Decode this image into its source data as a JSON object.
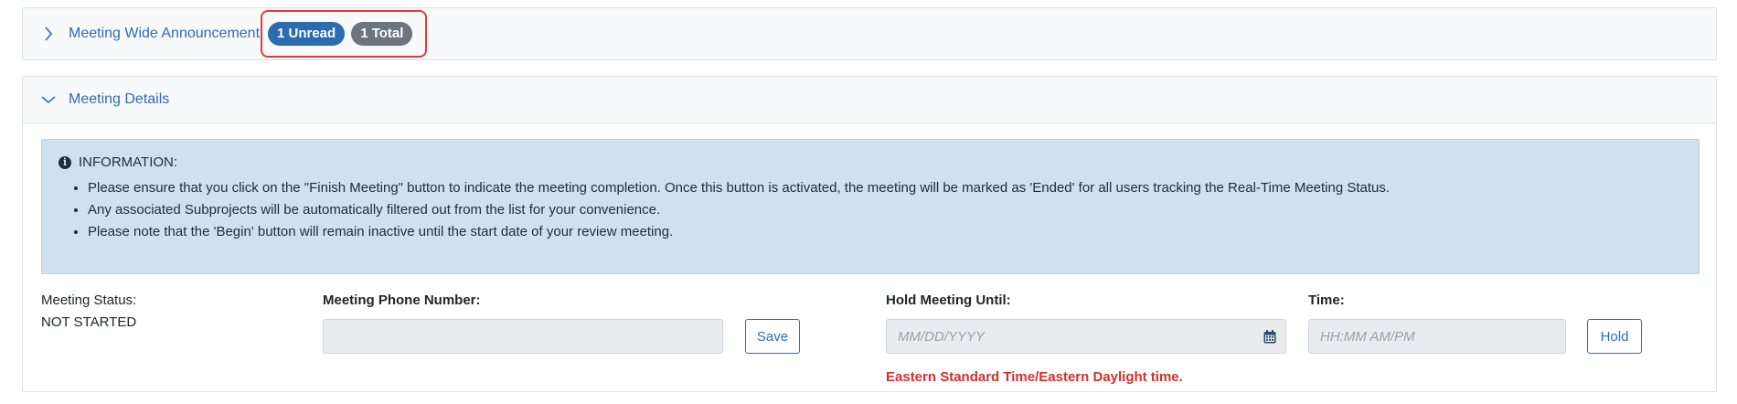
{
  "announcements": {
    "title": "Meeting Wide Announcement",
    "badges": {
      "unread": "1 Unread",
      "total": "1 Total"
    },
    "chevron": "chevron-right-icon"
  },
  "details": {
    "title": "Meeting Details",
    "chevron": "chevron-down-icon",
    "info": {
      "title": "INFORMATION:",
      "icon": "info-circle-icon",
      "items": [
        "Please ensure that you click on the \"Finish Meeting\" button to indicate the meeting completion. Once this button is activated, the meeting will be marked as 'Ended' for all users tracking the Real-Time Meeting Status.",
        "Any associated Subprojects will be automatically filtered out from the list for your convenience.",
        "Please note that the 'Begin' button will remain inactive until the start date of your review meeting."
      ]
    },
    "status": {
      "label": "Meeting Status:",
      "value": "NOT STARTED"
    },
    "phone": {
      "label": "Meeting Phone Number:",
      "value": "",
      "placeholder": "",
      "save_label": "Save"
    },
    "hold": {
      "label": "Hold Meeting Until:",
      "placeholder": "MM/DD/YYYY",
      "icon": "calendar-icon"
    },
    "time": {
      "label": "Time:",
      "placeholder": "HH:MM AM/PM",
      "hold_label": "Hold"
    },
    "timezone_note": "Eastern Standard Time/Eastern Daylight time."
  },
  "colors": {
    "link_blue": "#2d6cb5",
    "badge_unread": "#2b6cb0",
    "badge_total": "#6c757d",
    "highlight_border": "#e03c3c",
    "info_bg": "#cfe0f0",
    "warning_red": "#d0312d"
  }
}
